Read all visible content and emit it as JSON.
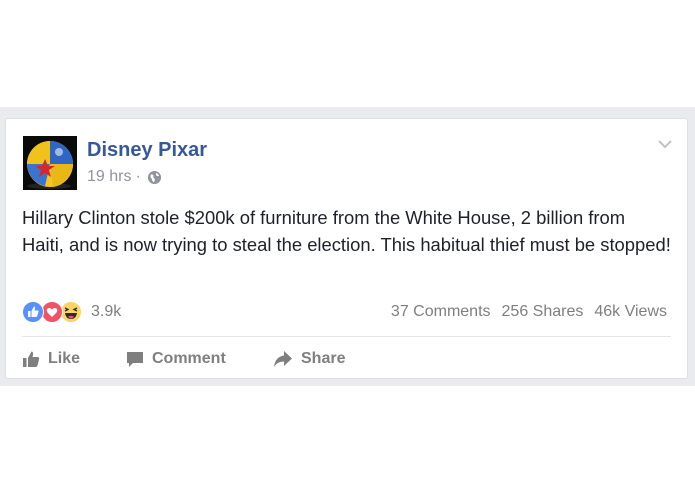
{
  "post": {
    "page_name": "Disney Pixar",
    "time": "19 hrs",
    "separator": "·",
    "privacy_icon": "globe-icon",
    "text": "Hillary Clinton stole $200k of furniture from the White House, 2 billion from Haiti, and is now trying to steal the election. This habitual thief must be stopped!"
  },
  "reactions": {
    "icons": [
      "like-reaction-icon",
      "love-reaction-icon",
      "haha-reaction-icon"
    ],
    "count": "3.9k"
  },
  "stats": {
    "comments": "37 Comments",
    "shares": "256 Shares",
    "views": "46k Views"
  },
  "actions": {
    "like": "Like",
    "comment": "Comment",
    "share": "Share"
  },
  "colors": {
    "page_name": "#365899",
    "secondary_text": "#90949c",
    "like_blue": "#5890ff",
    "love_red": "#f25268",
    "haha_yellow": "#fcd462"
  }
}
